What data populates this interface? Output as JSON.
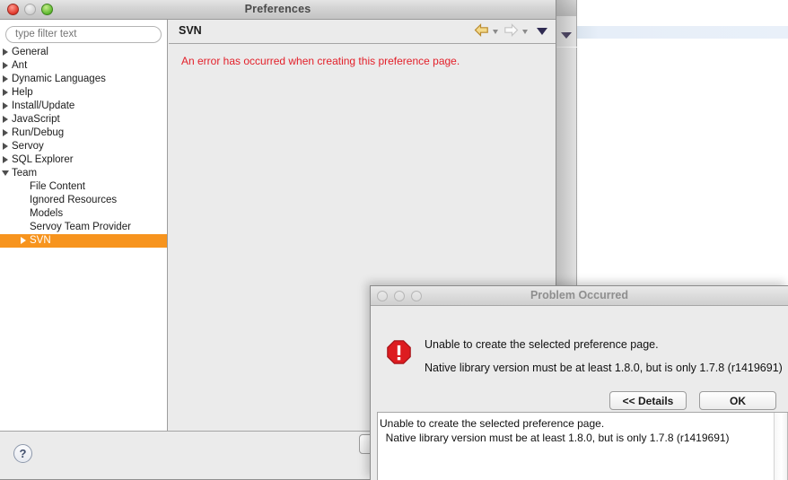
{
  "background_app": {
    "name": "background-window"
  },
  "preferences_window": {
    "title": "Preferences",
    "traffic_lights": [
      "close",
      "minimize",
      "zoom"
    ],
    "filter": {
      "placeholder": "type filter text",
      "value": ""
    },
    "tree": [
      {
        "label": "General",
        "level": 0,
        "expander": "collapsed",
        "selected": false
      },
      {
        "label": "Ant",
        "level": 0,
        "expander": "collapsed",
        "selected": false
      },
      {
        "label": "Dynamic Languages",
        "level": 0,
        "expander": "collapsed",
        "selected": false
      },
      {
        "label": "Help",
        "level": 0,
        "expander": "collapsed",
        "selected": false
      },
      {
        "label": "Install/Update",
        "level": 0,
        "expander": "collapsed",
        "selected": false
      },
      {
        "label": "JavaScript",
        "level": 0,
        "expander": "collapsed",
        "selected": false
      },
      {
        "label": "Run/Debug",
        "level": 0,
        "expander": "collapsed",
        "selected": false
      },
      {
        "label": "Servoy",
        "level": 0,
        "expander": "collapsed",
        "selected": false
      },
      {
        "label": "SQL Explorer",
        "level": 0,
        "expander": "collapsed",
        "selected": false
      },
      {
        "label": "Team",
        "level": 0,
        "expander": "expanded",
        "selected": false
      },
      {
        "label": "File Content",
        "level": 1,
        "expander": "none",
        "selected": false
      },
      {
        "label": "Ignored Resources",
        "level": 1,
        "expander": "none",
        "selected": false
      },
      {
        "label": "Models",
        "level": 1,
        "expander": "none",
        "selected": false
      },
      {
        "label": "Servoy Team Provider",
        "level": 1,
        "expander": "none",
        "selected": false
      },
      {
        "label": "SVN",
        "level": 1,
        "expander": "collapsed",
        "selected": true
      }
    ],
    "content": {
      "title": "SVN",
      "error_message": "An error has occurred when creating this preference page.",
      "toolbar": {
        "back_icon": "back-arrow-icon",
        "back_dropdown_icon": "chevron-down-icon",
        "forward_icon": "forward-arrow-icon",
        "forward_dropdown_icon": "chevron-down-icon",
        "menu_icon": "view-menu-icon"
      }
    },
    "footer": {
      "help_label": "?",
      "partial_button_label": ""
    },
    "selection_color": "#f7941e",
    "error_color": "#e3202a"
  },
  "dialog": {
    "title": "Problem Occurred",
    "icon": "error-stop-icon",
    "message_line1": "Unable to create the selected preference page.",
    "message_line2": "Native library version must be at least 1.8.0, but is only 1.7.8 (r1419691)",
    "buttons": {
      "details_label": "<< Details",
      "ok_label": "OK"
    },
    "details_text": "Unable to create the selected preference page.\n  Native library version must be at least 1.8.0, but is only 1.7.8 (r1419691)"
  }
}
